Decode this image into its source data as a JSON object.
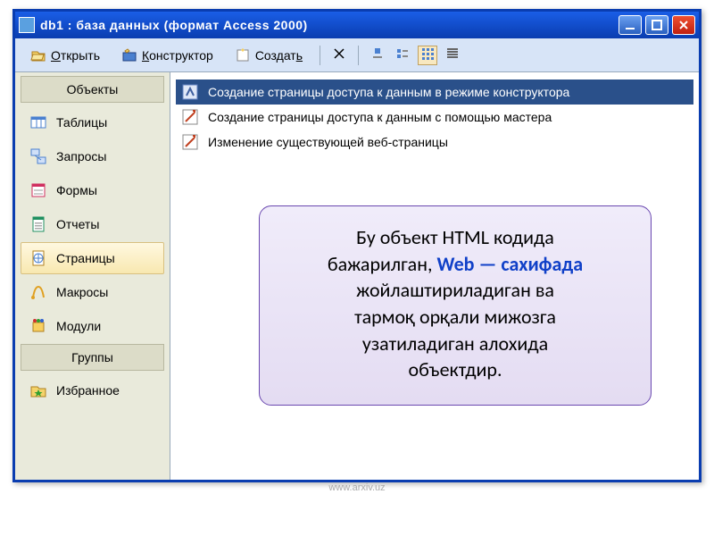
{
  "window": {
    "title": "db1 : база данных (формат Access 2000)"
  },
  "toolbar": {
    "open_label": "Открыть",
    "design_label": "Конструктор",
    "create_label": "Создать"
  },
  "sidebar": {
    "section_objects": "Объекты",
    "section_groups": "Группы",
    "items": [
      {
        "label": "Таблицы"
      },
      {
        "label": "Запросы"
      },
      {
        "label": "Формы"
      },
      {
        "label": "Отчеты"
      },
      {
        "label": "Страницы"
      },
      {
        "label": "Макросы"
      },
      {
        "label": "Модули"
      }
    ],
    "favorites_label": "Избранное"
  },
  "main": {
    "items": [
      {
        "label": "Создание страницы доступа к данным в режиме конструктора"
      },
      {
        "label": "Создание страницы доступа к данным с помощью мастера"
      },
      {
        "label": "Изменение существующей веб-страницы"
      }
    ]
  },
  "callout": {
    "line1": "Бу объект HTML кодида",
    "line2a": "бажарилган, ",
    "line2b": "Web — сахифада",
    "line3": "жойлаштириладиган ва",
    "line4": "тармоқ орқали мижозга",
    "line5": "узатиладиган алохида",
    "line6": "объектдир."
  },
  "watermark": {
    "text": "ARXIV.UZ",
    "footer": "www.arxiv.uz"
  }
}
